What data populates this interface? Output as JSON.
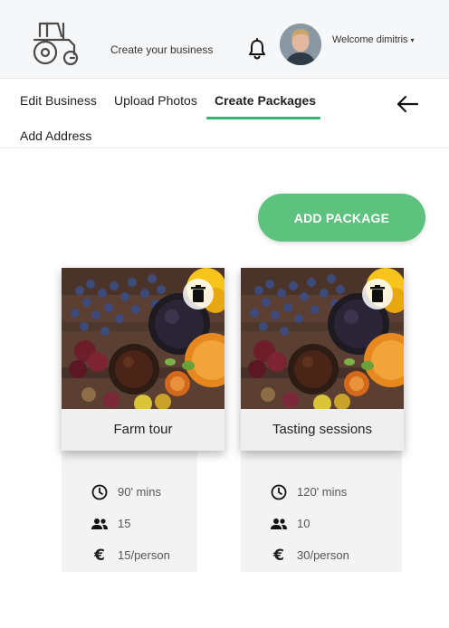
{
  "header": {
    "create_business": "Create your business",
    "welcome": "Welcome dimitris",
    "caret": "▾"
  },
  "tabs": [
    {
      "label": "Edit Business",
      "active": false
    },
    {
      "label": "Upload Photos",
      "active": false
    },
    {
      "label": "Create Packages",
      "active": true
    },
    {
      "label": "Add Address",
      "active": false
    }
  ],
  "actions": {
    "add_package": "ADD PACKAGE"
  },
  "packages": [
    {
      "title": "Farm tour",
      "duration": "90' mins",
      "people": "15",
      "price": "15/person"
    },
    {
      "title": "Tasting sessions",
      "duration": "120' mins",
      "people": "10",
      "price": "30/person"
    }
  ],
  "icons": {
    "logo": "tractor-icon",
    "notifications": "bell-icon",
    "back": "arrow-left-icon",
    "delete": "trash-icon",
    "duration": "clock-icon",
    "people": "people-icon",
    "price": "euro-icon"
  },
  "colors": {
    "accent": "#3bb273",
    "button": "#5dc27d",
    "header_bg": "#f6f7f9"
  }
}
